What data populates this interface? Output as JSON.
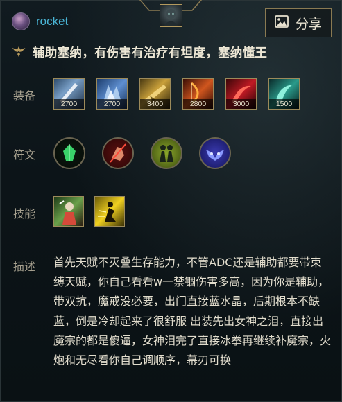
{
  "user": {
    "name": "rocket"
  },
  "header": {
    "share_label": "分享",
    "share_icon": "image-icon",
    "champion_icon": "champion-portrait"
  },
  "build": {
    "role_icon": "support-role-icon",
    "title": "辅助塞纳，有伤害有治疗有坦度，塞纳懂王"
  },
  "sections": {
    "items_label": "装备",
    "runes_label": "符文",
    "spells_label": "技能",
    "desc_label": "描述"
  },
  "items": [
    {
      "icon": "white-blade-item-icon",
      "price": "2700"
    },
    {
      "icon": "ice-shard-item-icon",
      "price": "2700"
    },
    {
      "icon": "golden-gun-item-icon",
      "price": "3400"
    },
    {
      "icon": "fire-bow-item-icon",
      "price": "2800"
    },
    {
      "icon": "red-scythe-item-icon",
      "price": "3000"
    },
    {
      "icon": "teal-scythe-item-icon",
      "price": "1500"
    }
  ],
  "runes": [
    {
      "icon": "green-crystal-rune-icon"
    },
    {
      "icon": "red-fist-rune-icon"
    },
    {
      "icon": "twin-figures-rune-icon"
    },
    {
      "icon": "owl-mask-rune-icon"
    }
  ],
  "spells": [
    {
      "icon": "heal-spell-icon"
    },
    {
      "icon": "flash-spell-icon"
    }
  ],
  "description": "首先天赋不灭叠生存能力，不管ADC还是辅助都要带束缚天赋，你自己看看w一禁锢伤害多高，因为你是辅助，带双抗，魔戒没必要，出门直接蓝水晶，后期根本不缺蓝，倒是冷却起来了很舒服 出装先出女神之泪，直接出魔宗的都是傻逼，女神泪完了直接冰拳再继续补魔宗，火炮和无尽看你自己调顺序，幕刃可换",
  "colors": {
    "username": "#4ab5d6",
    "gold_border": "#9c8a5a",
    "background": "#0c1418"
  }
}
